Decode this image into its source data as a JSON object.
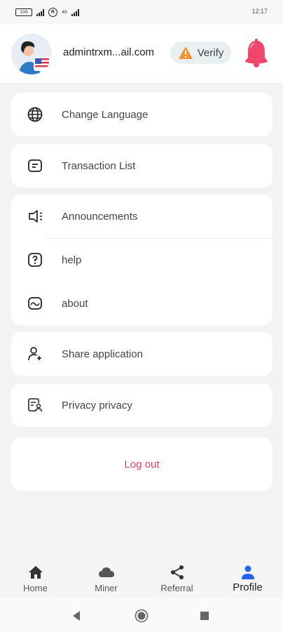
{
  "status_bar": {
    "battery": "100",
    "roaming": "R",
    "network": "4G",
    "time": "12:17"
  },
  "header": {
    "email": "admintrxm...ail.com",
    "verify_label": "Verify"
  },
  "menu": {
    "change_language": "Change Language",
    "transaction_list": "Transaction List",
    "announcements": "Announcements",
    "help": "help",
    "about": "about",
    "share_application": "Share application",
    "privacy": "Privacy privacy",
    "logout": "Log out"
  },
  "bottom_nav": {
    "home": "Home",
    "miner": "Miner",
    "referral": "Referral",
    "profile": "Profile",
    "active": "profile"
  },
  "colors": {
    "accent_red": "#e0405e",
    "bell_pink": "#f0466e",
    "active_blue": "#2563eb",
    "warning_orange": "#f5922a"
  }
}
